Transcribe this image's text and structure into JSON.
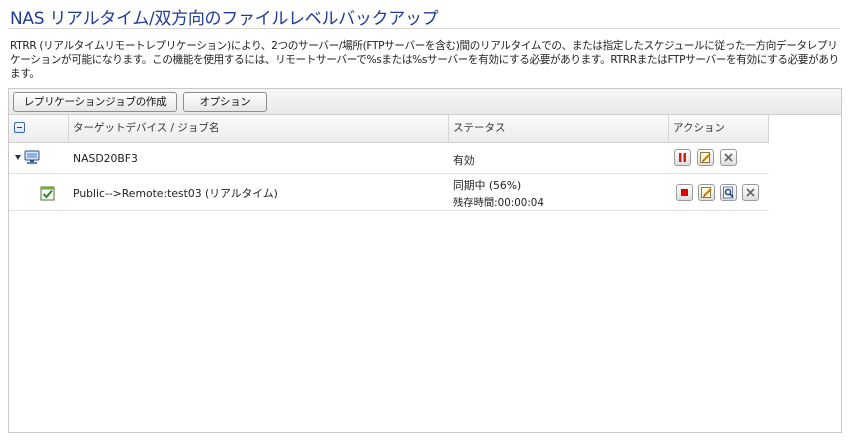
{
  "page": {
    "title": "NAS リアルタイム/双方向のファイルレベルバックアップ",
    "description": "RTRR (リアルタイムリモートレプリケーション)により、2つのサーバー/場所(FTPサーバーを含む)間のリアルタイムでの、または指定したスケジュールに従った一方向データレプリケーションが可能になります。この機能を使用するには、リモートサーバーで%sまたは%sサーバーを有効にする必要があります。RTRRまたはFTPサーバーを有効にする必要があります。"
  },
  "toolbar": {
    "create_job_label": "レプリケーションジョブの作成",
    "options_label": "オプション"
  },
  "table": {
    "columns": [
      "",
      "ターゲットデバイス / ジョブ名",
      "ステータス",
      "アクション"
    ],
    "device": {
      "name": "NASD20BF3",
      "status": "有効",
      "actions": [
        "pause-icon",
        "edit-icon",
        "delete-icon"
      ]
    },
    "job": {
      "name": "Public-->Remote:test03 (リアルタイム)",
      "status_line1": "同期中 (56%)",
      "status_line2": "残存時間:00:00:04",
      "progress_percent": 56,
      "actions": [
        "stop-icon",
        "edit-icon",
        "view-log-icon",
        "delete-icon"
      ]
    }
  },
  "colors": {
    "title": "#1f3c99",
    "pause": "#d02020",
    "stop": "#e00000"
  }
}
